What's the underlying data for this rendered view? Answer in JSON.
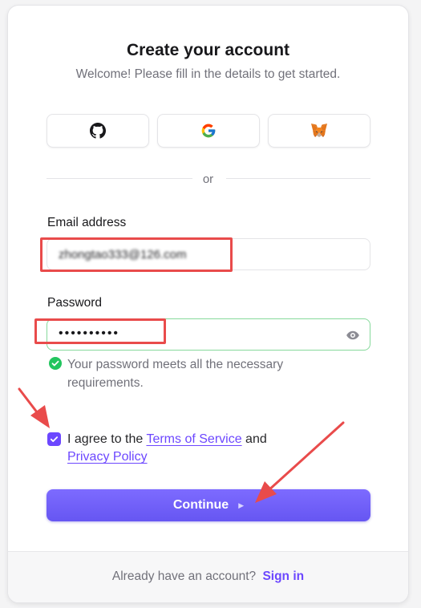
{
  "header": {
    "title": "Create your account",
    "subtitle": "Welcome! Please fill in the details to get started."
  },
  "social": [
    {
      "name": "github",
      "icon": "github-icon"
    },
    {
      "name": "google",
      "icon": "google-icon"
    },
    {
      "name": "metamask",
      "icon": "metamask-fox-icon"
    }
  ],
  "divider_label": "or",
  "email": {
    "label": "Email address",
    "value": "zhongtao333@126.com"
  },
  "password": {
    "label": "Password",
    "value": "••••••••••",
    "toggle_icon": "eye-icon",
    "hint": "Your password meets all the necessary requirements.",
    "hint_icon": "check-circle-icon"
  },
  "agreement": {
    "checked": true,
    "prefix": "I agree to the",
    "terms_link": "Terms of Service",
    "middle": "and",
    "privacy_link": "Privacy Policy"
  },
  "continue": {
    "label": "Continue",
    "icon": "caret-right-icon"
  },
  "footer": {
    "text": "Already have an account?",
    "link": "Sign in"
  },
  "colors": {
    "accent": "#6c47ff",
    "button": "#6e5ff6",
    "success": "#22c55e",
    "annotation": "#e94b4b"
  }
}
